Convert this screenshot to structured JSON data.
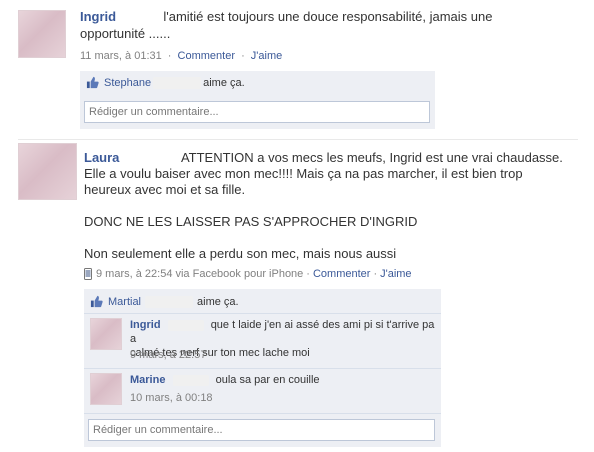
{
  "post1": {
    "author": "Ingrid",
    "message_line1": "l'amitié est toujours une douce responsabilité, jamais une",
    "message_line2": "opportunité ......",
    "timestamp": "11 mars, à 01:31",
    "actions": {
      "comment": "Commenter",
      "like": "J'aime"
    },
    "likes": {
      "person": "Stephane",
      "suffix": "aime ça."
    },
    "comment_placeholder": "Rédiger un commentaire..."
  },
  "post2": {
    "author": "Laura",
    "message_line1": "ATTENTION a vos mecs les meufs, Ingrid est une vrai chaudasse.",
    "message_line2": "Elle a voulu baiser avec mon mec!!!! Mais ça na pas marcher, il est bien trop",
    "message_line3": "heureux avec moi et sa fille.",
    "message_line4": "DONC NE LES LAISSER PAS S'APPROCHER D'INGRID",
    "message_line5": "Non seulement elle a perdu son mec, mais nous aussi",
    "timestamp": "9 mars, à 22:54 via Facebook pour iPhone",
    "actions": {
      "comment": "Commenter",
      "like": "J'aime"
    },
    "likes": {
      "person": "Martial",
      "suffix": "aime ça."
    },
    "comments": [
      {
        "author": "Ingrid",
        "text_line1": "que t laide j'en ai assé des ami pi si t'arrive pa a",
        "text_line2": "calmé tes nerf sur ton mec lache moi",
        "timestamp": "9 mars, à 22:57"
      },
      {
        "author": "Marine",
        "text_line1": "oula sa par en couille",
        "timestamp": "10 mars, à 00:18"
      }
    ],
    "comment_placeholder": "Rédiger un commentaire..."
  },
  "icons": {
    "like": "thumbs-up-icon",
    "mobile": "mobile-phone-icon"
  },
  "colors": {
    "link": "#3b5998",
    "ufi_bg": "#edeff4",
    "meta": "#808080"
  }
}
